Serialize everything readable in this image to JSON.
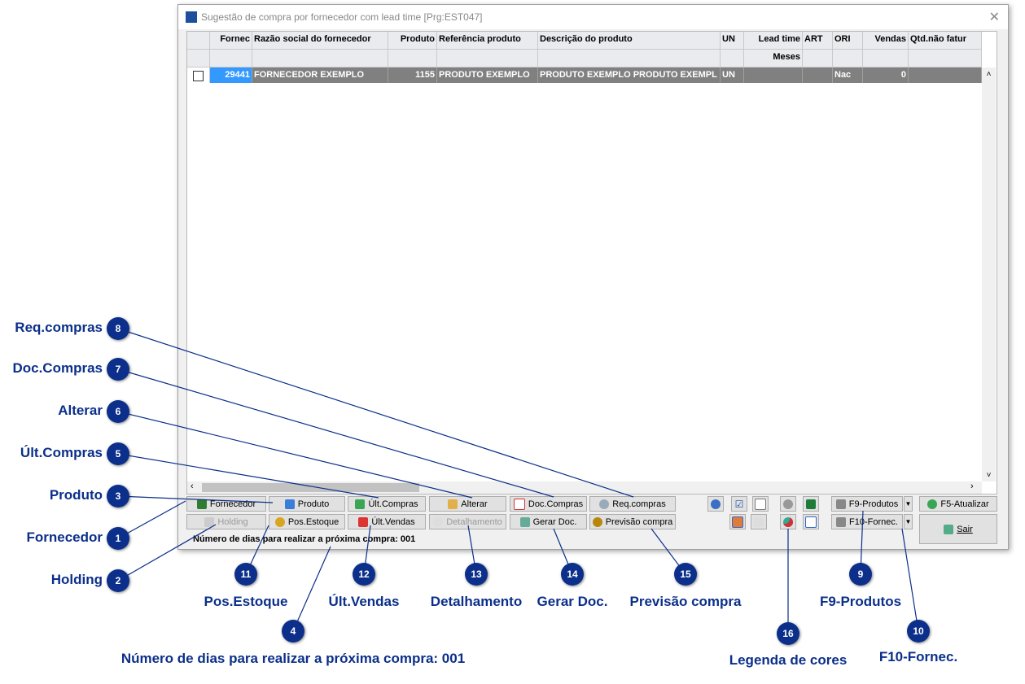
{
  "window": {
    "title": "Sugestão de compra por fornecedor com lead time [Prg:EST047]",
    "close": "✕"
  },
  "grid": {
    "headers": [
      "",
      "Fornec",
      "Razão social do fornecedor",
      "Produto",
      "Referência produto",
      "Descrição do produto",
      "UN",
      "Lead time",
      "ART",
      "ORI",
      "Vendas",
      "Qtd.não fatur"
    ],
    "subheaders": [
      "",
      "",
      "",
      "",
      "",
      "",
      "",
      "Meses",
      "",
      "",
      "",
      ""
    ],
    "rows": [
      {
        "fornec": "29441",
        "razao": "FORNECEDOR EXEMPLO",
        "produto": "1155",
        "referencia": "PRODUTO EXEMPLO",
        "descricao": "PRODUTO EXEMPLO PRODUTO EXEMPL",
        "un": "UN",
        "lead": "",
        "art": "",
        "ori": "Nac",
        "vendas": "0",
        "qtd": ""
      }
    ]
  },
  "buttons": {
    "fornecedor": "Fornecedor",
    "produto": "Produto",
    "ult_compras": "Últ.Compras",
    "alterar": "Alterar",
    "doc_compras": "Doc.Compras",
    "req_compras": "Req.compras",
    "holding": "Holding",
    "pos_estoque": "Pos.Estoque",
    "ult_vendas": "Últ.Vendas",
    "detalhamento": "Detalhamento",
    "gerar_doc": "Gerar Doc.",
    "previsao": "Previsão compra",
    "f9": "F9-Produtos",
    "f10": "F10-Fornec.",
    "f5": "F5-Atualizar",
    "sair": "Sair"
  },
  "status": "Número de dias  para realizar a próxima compra: 001",
  "callouts": [
    {
      "n": "1",
      "label": "Fornecedor"
    },
    {
      "n": "2",
      "label": "Holding"
    },
    {
      "n": "3",
      "label": "Produto"
    },
    {
      "n": "4",
      "label": "Número de dias  para realizar a próxima compra: 001"
    },
    {
      "n": "5",
      "label": "Últ.Compras"
    },
    {
      "n": "6",
      "label": "Alterar"
    },
    {
      "n": "7",
      "label": "Doc.Compras"
    },
    {
      "n": "8",
      "label": "Req.compras"
    },
    {
      "n": "9",
      "label": "F9-Produtos"
    },
    {
      "n": "10",
      "label": "F10-Fornec."
    },
    {
      "n": "11",
      "label": "Pos.Estoque"
    },
    {
      "n": "12",
      "label": "Últ.Vendas"
    },
    {
      "n": "13",
      "label": "Detalhamento"
    },
    {
      "n": "14",
      "label": "Gerar Doc."
    },
    {
      "n": "15",
      "label": "Previsão compra"
    },
    {
      "n": "16",
      "label": "Legenda de cores"
    }
  ]
}
